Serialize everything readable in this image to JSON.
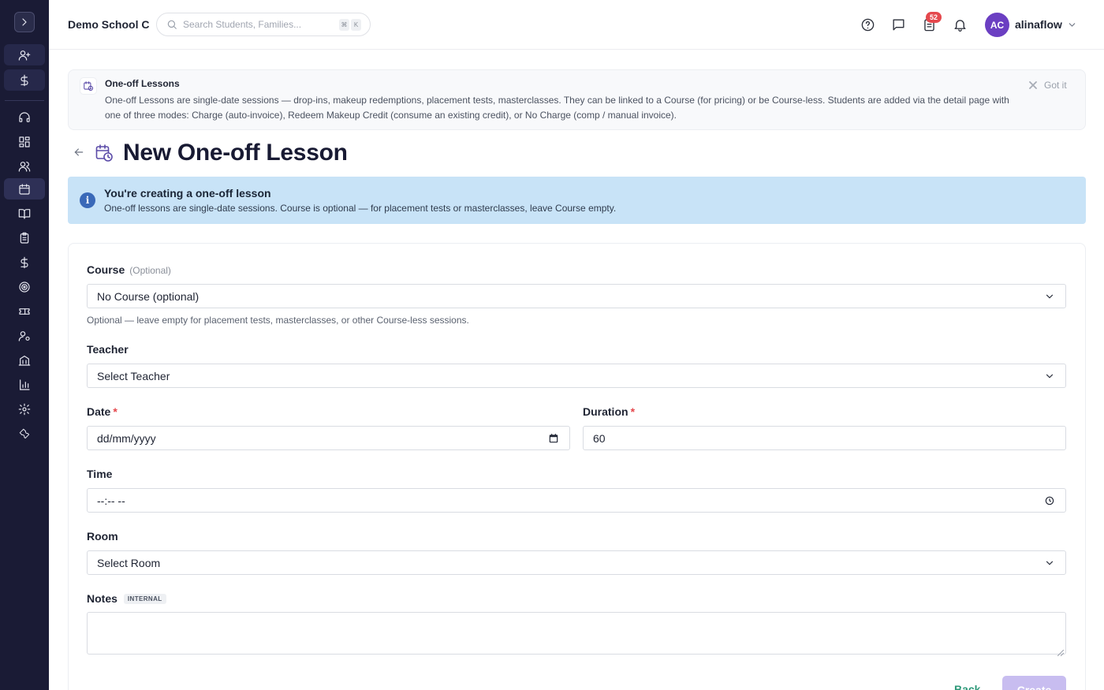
{
  "topbar": {
    "school_name": "Demo School C",
    "search_placeholder": "Search Students, Families...",
    "kbd_cmd": "⌘",
    "kbd_k": "K",
    "tasks_badge": "52",
    "avatar_initials": "AC",
    "username": "alinaflow"
  },
  "tip": {
    "title": "One-off Lessons",
    "body": "One-off Lessons are single-date sessions — drop-ins, makeup redemptions, placement tests, masterclasses. They can be linked to a Course (for pricing) or be Course-less. Students are added via the detail page with one of three modes: Charge (auto-invoice), Redeem Makeup Credit (consume an existing credit), or No Charge (comp / manual invoice).",
    "dismiss_label": "Got it"
  },
  "page": {
    "title": "New One-off Lesson"
  },
  "alert": {
    "icon": "i",
    "title": "You're creating a one-off lesson",
    "body": "One-off lessons are single-date sessions. Course is optional — for placement tests or masterclasses, leave Course empty."
  },
  "form": {
    "course_label": "Course",
    "course_optional": "(Optional)",
    "course_value": "No Course (optional)",
    "course_help": "Optional — leave empty for placement tests, masterclasses, or other Course-less sessions.",
    "teacher_label": "Teacher",
    "teacher_value": "Select Teacher",
    "date_label": "Date",
    "date_required": "*",
    "date_value": "dd/mm/yyyy",
    "duration_label": "Duration",
    "duration_required": "*",
    "duration_value": "60",
    "time_label": "Time",
    "time_value": "--:-- --",
    "room_label": "Room",
    "room_value": "Select Room",
    "notes_label": "Notes",
    "notes_tag": "INTERNAL",
    "notes_value": "",
    "back_label": "Back",
    "create_label": "Create"
  },
  "colors": {
    "sidebar_bg": "#1a1b35",
    "accent_purple": "#5b4ba8",
    "alert_bg": "#c8e3f7",
    "badge_red": "#e5484d",
    "create_disabled": "#c8bdf0",
    "back_green": "#2f9a7a"
  }
}
